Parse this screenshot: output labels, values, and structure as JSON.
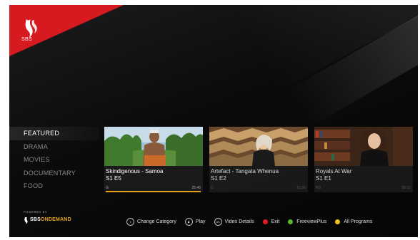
{
  "brand": {
    "logo_text": "SBS",
    "powered_by": "POWERED BY",
    "name_part1": "SBS",
    "name_part2": "ONDEMAND",
    "colors": {
      "red": "#d71920",
      "accent": "#e6a11c"
    }
  },
  "categories": [
    {
      "label": "FEATURED",
      "active": true
    },
    {
      "label": "DRAMA",
      "active": false
    },
    {
      "label": "MOVIES",
      "active": false
    },
    {
      "label": "DOCUMENTARY",
      "active": false
    },
    {
      "label": "FOOD",
      "active": false
    }
  ],
  "tiles": [
    {
      "title": "Skindigenous - Samoa",
      "episode": "S1 E5",
      "rating": "G",
      "duration": "25:46",
      "progress": 1.0,
      "selected": true,
      "image": "man-tattoo-tropical"
    },
    {
      "title": "Artefact - Tangata Whenua",
      "episode": "S1 E2",
      "rating": "G",
      "duration": "51:56",
      "progress": 0,
      "selected": false,
      "image": "woman-gallery"
    },
    {
      "title": "Royals At War",
      "episode": "S1 E1",
      "rating": "PG",
      "duration": "56:22",
      "progress": 0,
      "selected": false,
      "image": "woman-library"
    }
  ],
  "footer": [
    {
      "icon": "up-down-ring-icon",
      "label": "Change Category"
    },
    {
      "icon": "play-ring-icon",
      "label": "Play"
    },
    {
      "icon": "ok-ring-icon",
      "glyph": "OK",
      "label": "Video Details"
    },
    {
      "icon": "red-dot-icon",
      "color": "#e31b23",
      "label": "Exit"
    },
    {
      "icon": "green-dot-icon",
      "color": "#5cb531",
      "label": "FreeviewPlus"
    },
    {
      "icon": "yellow-dot-icon",
      "color": "#f2c21b",
      "label": "All Programs"
    }
  ]
}
